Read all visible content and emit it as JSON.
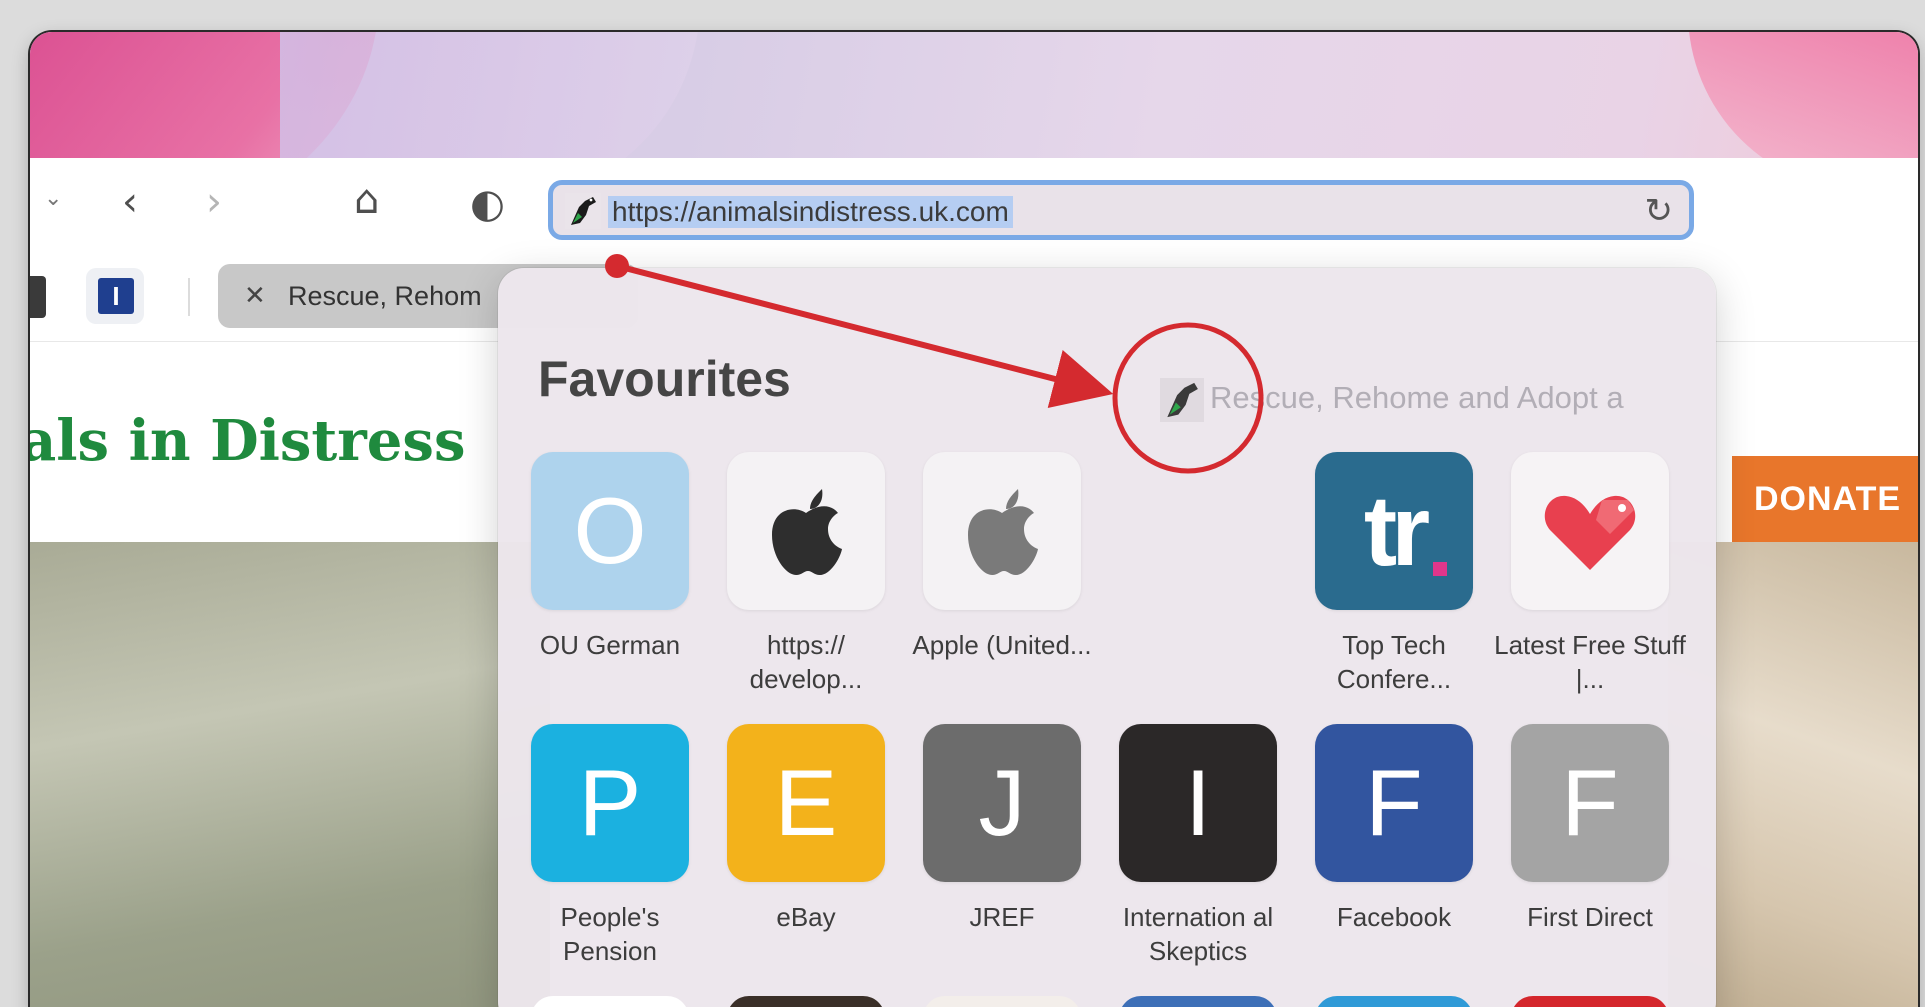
{
  "toolbar": {
    "chevron": "⌄",
    "back": "‹",
    "forward": "›",
    "home": "⌂",
    "shield": "◐",
    "url": "https://animalsindistress.uk.com",
    "reload": "↻"
  },
  "tabs": {
    "pinned_letter": "I",
    "active_close": "✕",
    "active_title": "Rescue, Rehom"
  },
  "page": {
    "site_title": "als in Distress",
    "donate": "DONATE"
  },
  "favourites": {
    "heading": "Favourites",
    "drag_label": "Rescue, Rehome and Adopt a",
    "tiles": [
      {
        "letter": "O",
        "label": "OU German",
        "color": "#aed3ed"
      },
      {
        "letter": "",
        "label": "https:// develop...",
        "color": "#f4f2f4",
        "icon": "apple-logo-black"
      },
      {
        "letter": "",
        "label": "Apple (United...",
        "color": "#f4f2f4",
        "icon": "apple-logo-grey"
      },
      {
        "letter": "tr",
        "label": "Top Tech Confere...",
        "color": "#2a6b8e"
      },
      {
        "letter": "",
        "label": "Latest Free Stuff |...",
        "color": "#f6f3f5",
        "icon": "heart-tag"
      },
      {
        "letter": "P",
        "label": "People's Pension",
        "color": "#1bb1e0"
      },
      {
        "letter": "E",
        "label": "eBay",
        "color": "#f3b21b"
      },
      {
        "letter": "J",
        "label": "JREF",
        "color": "#6c6c6c"
      },
      {
        "letter": "I",
        "label": "Internation al Skeptics",
        "color": "#2b2828"
      },
      {
        "letter": "F",
        "label": "Facebook",
        "color": "#32559f"
      },
      {
        "letter": "F",
        "label": "First Direct",
        "color": "#a4a4a4"
      }
    ]
  },
  "colors": {
    "accent_highlight": "#b5cdf2",
    "address_border": "#7aa9e6",
    "site_green": "#1f8a3e",
    "donate_orange": "#e8762b",
    "annotation_red": "#d42a2f"
  }
}
